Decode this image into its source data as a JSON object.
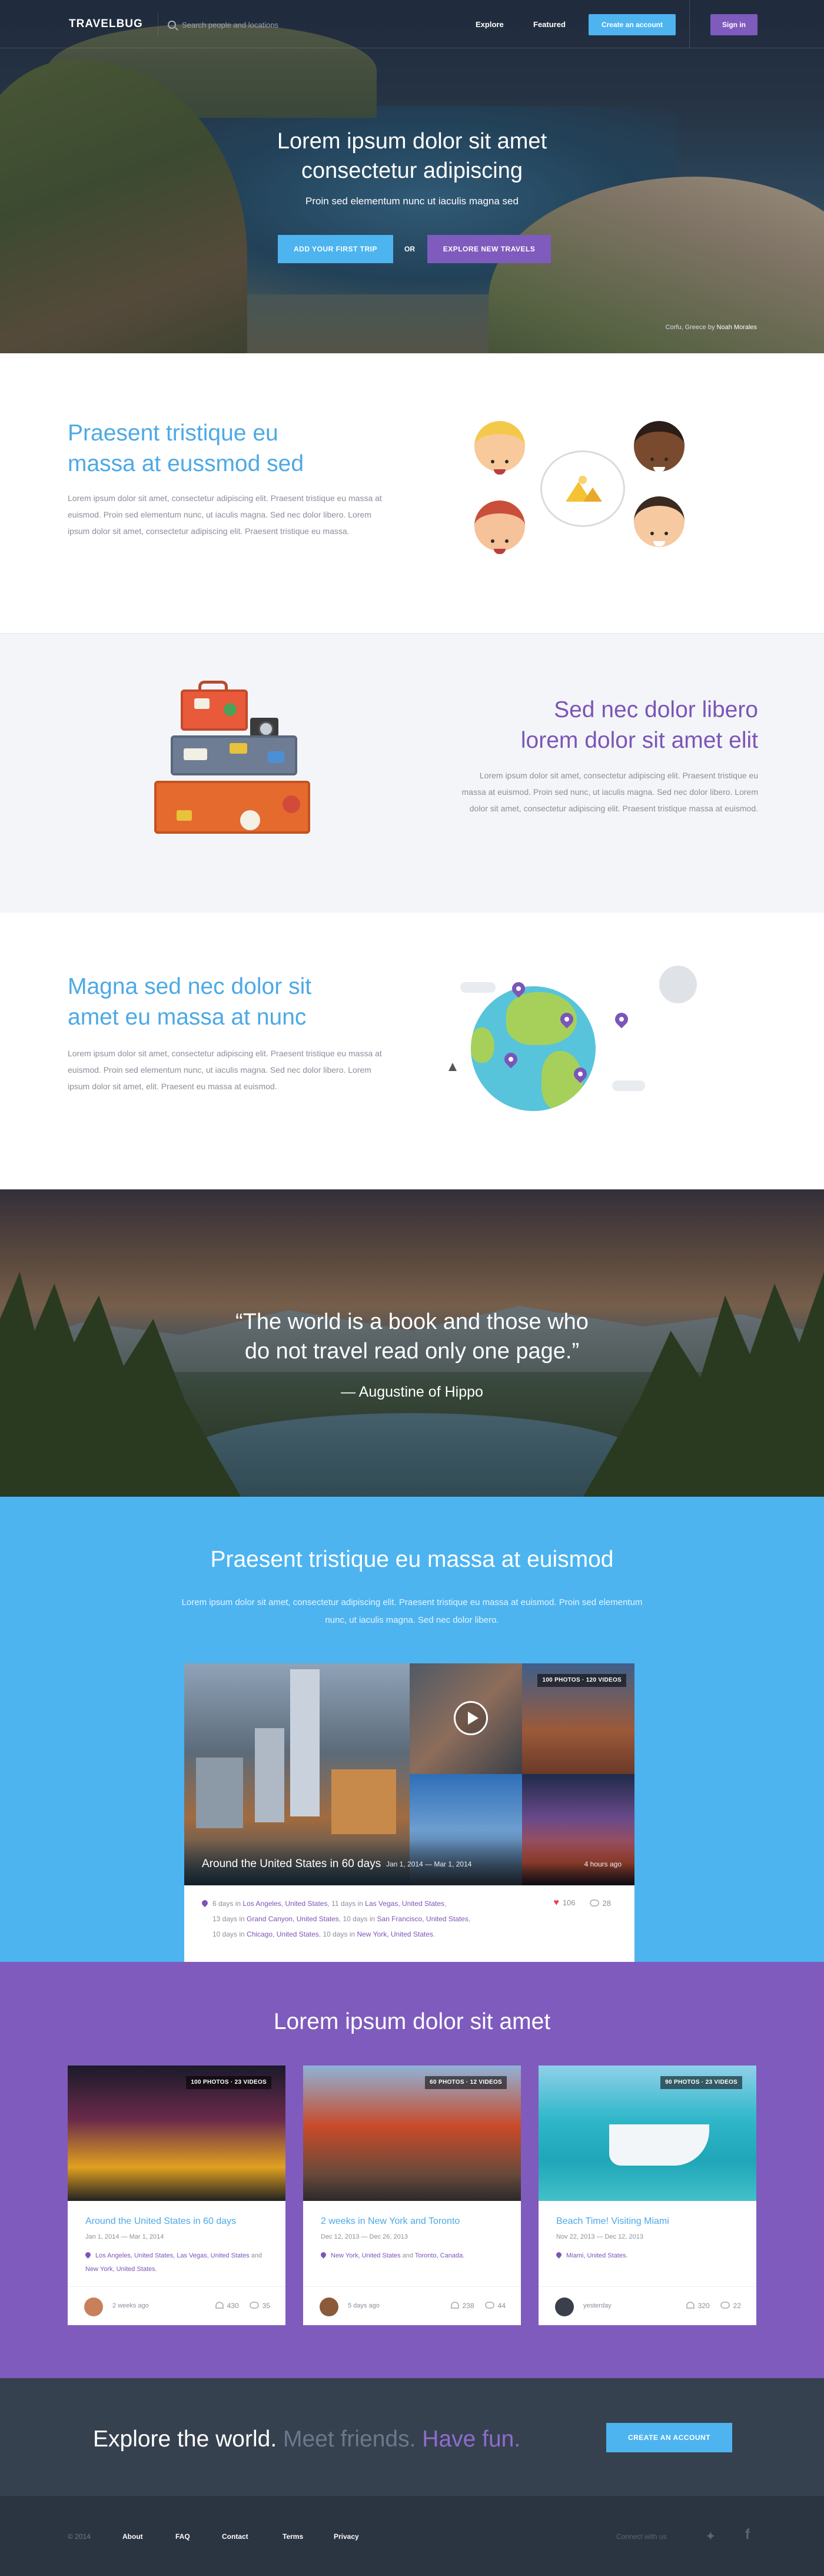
{
  "nav": {
    "logo": "TRAVELBUG",
    "search_placeholder": "Search people and locations",
    "explore": "Explore",
    "featured": "Featured",
    "create_account": "Create an account",
    "sign_in": "Sign in"
  },
  "hero": {
    "title_line1": "Lorem ipsum dolor sit amet",
    "title_line2": "consectetur adipiscing",
    "subtitle": "Proin sed elementum nunc ut iaculis magna sed",
    "btn_primary": "ADD YOUR FIRST TRIP",
    "or": "OR",
    "btn_secondary": "EXPLORE NEW TRAVELS",
    "credit_place": "Corfu, Greece",
    "credit_by": "by",
    "credit_author": "Noah Morales"
  },
  "features": [
    {
      "title_line1": "Praesent tristique eu",
      "title_line2": "massa at eussmod sed",
      "body": "Lorem ipsum dolor sit amet, consectetur adipiscing elit. Praesent tristique eu massa at euismod. Proin sed elementum nunc, ut iaculis magna. Sed nec dolor libero. Lorem ipsum dolor sit amet, consectetur adipiscing elit. Praesent tristique eu massa."
    },
    {
      "title_line1": "Sed nec dolor libero",
      "title_line2": "lorem dolor sit amet elit",
      "body": "Lorem ipsum dolor sit amet, consectetur adipiscing elit. Praesent tristique eu massa at euismod. Proin sed nunc, ut iaculis magna. Sed nec dolor libero. Lorem dolor sit amet, consectetur adipiscing elit. Praesent tristique massa at euismod."
    },
    {
      "title_line1": "Magna sed nec dolor sit",
      "title_line2": "amet eu massa at nunc",
      "body": "Lorem ipsum dolor sit amet, consectetur adipiscing elit. Praesent tristique eu massa at euismod. Proin sed elementum nunc, ut iaculis magna. Sed nec dolor libero. Lorem ipsum dolor sit amet, elit. Praesent eu massa at euismod."
    }
  ],
  "quote": {
    "line1": "“The world is a book and those who",
    "line2": "do not travel read only one page.”",
    "author": "— Augustine of Hippo"
  },
  "featured_trip": {
    "heading": "Praesent tristique eu massa at euismod",
    "intro": "Lorem ipsum dolor sit amet, consectetur adipiscing elit. Praesent tristique eu massa at euismod. Proin sed elementum nunc, ut iaculis magna. Sed nec dolor libero.",
    "tag": "100 PHOTOS · 120 VIDEOS",
    "title": "Around the United States in 60 days",
    "dates": "Jan 1, 2014 — Mar 1, 2014",
    "ago": "4 hours ago",
    "route": [
      {
        "pre": "6 days in ",
        "place": "Los Angeles, United States",
        "sep": ", 11 days in ",
        "place2": "Las Vegas, United States",
        "end": ","
      },
      {
        "pre": "13 days in ",
        "place": "Grand Canyon, United States",
        "sep": ", 10 days in ",
        "place2": "San Francisco, United States",
        "end": ","
      },
      {
        "pre": "10 days in ",
        "place": "Chicago, United States",
        "sep": ", 10 days in ",
        "place2": "New York, United States",
        "end": "."
      }
    ],
    "likes": "106",
    "comments": "28"
  },
  "trips": {
    "heading": "Lorem ipsum dolor sit amet",
    "cards": [
      {
        "tag": "100 PHOTOS · 23 VIDEOS",
        "title": "Around the United States in 60 days",
        "dates": "Jan 1, 2014 — Mar 1, 2014",
        "locations": "Los Angeles, United States, Las Vegas, United States",
        "locations_join": " and ",
        "locations_last": "New York, United States.",
        "ago": "2 weeks ago",
        "likes": "430",
        "comments": "35"
      },
      {
        "tag": "60 PHOTOS · 12 VIDEOS",
        "title": "2 weeks in New York and Toronto",
        "dates": "Dec 12, 2013 — Dec 26, 2013",
        "locations": "New York, United States",
        "locations_join": " and ",
        "locations_last": "Toronto, Canada.",
        "ago": "5 days ago",
        "likes": "238",
        "comments": "44"
      },
      {
        "tag": "90 PHOTOS · 23 VIDEOS",
        "title": "Beach Time! Visiting Miami",
        "dates": "Nov 22, 2013 — Dec 12, 2013",
        "locations": "Miami, United States.",
        "locations_join": "",
        "locations_last": "",
        "ago": "yesterday",
        "likes": "320",
        "comments": "22"
      }
    ]
  },
  "cta": {
    "part1": "Explore the world.",
    "part2": "Meet friends.",
    "part3": "Have fun.",
    "button": "CREATE AN ACCOUNT"
  },
  "footer": {
    "copyright": "© 2014",
    "links": [
      "About",
      "FAQ",
      "Contact",
      "Terms",
      "Privacy"
    ],
    "connect": "Connect with us"
  },
  "colors": {
    "blue": "#4db4f0",
    "purple": "#7f5bbd",
    "dark": "#36414f",
    "footer": "#2b3441"
  }
}
